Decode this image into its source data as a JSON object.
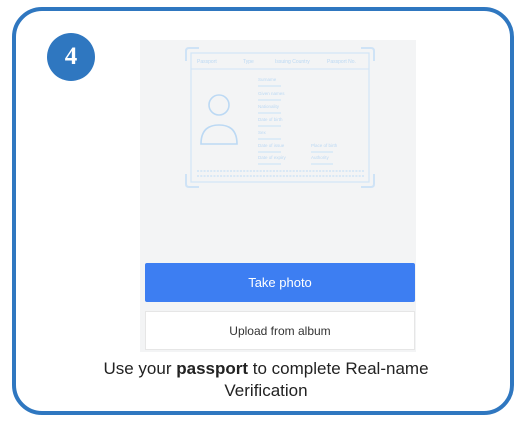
{
  "step": {
    "number": "4"
  },
  "passport_guide": {
    "tabs": [
      "Passport",
      "Type",
      "Issuing Country",
      "Passport No."
    ],
    "fields": [
      "Surname",
      "Given names",
      "Nationality",
      "Date of birth",
      "Sex",
      "Date of issue",
      "Place of birth",
      "Date of expiry",
      "Authority"
    ]
  },
  "buttons": {
    "take_photo": "Take photo",
    "upload_album": "Upload from album"
  },
  "instruction": {
    "prefix": "Use your",
    "emphasis": "passport",
    "middle": "to complete Real-name",
    "suffix": "Verification"
  },
  "colors": {
    "frame": "#2f77c0",
    "badge": "#2f77c0",
    "primary_button": "#3d7ef2",
    "guide_lines": "#bcd9f4"
  }
}
